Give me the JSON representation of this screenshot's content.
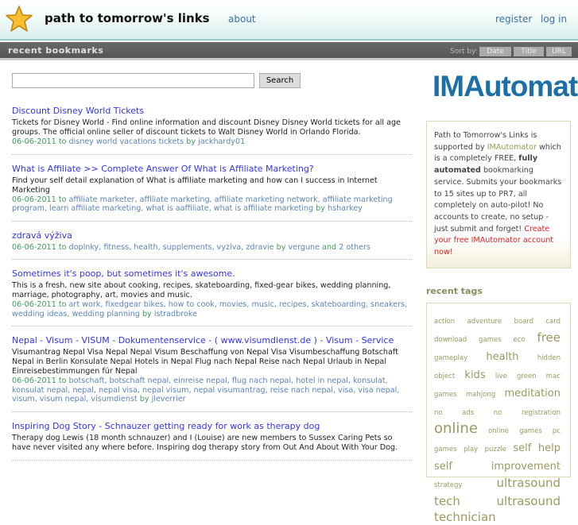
{
  "header": {
    "title": "path to tomorrow's links",
    "about": "about",
    "register": "register",
    "login": "log in"
  },
  "bar": {
    "title": "recent bookmarks",
    "sort_by": "Sort by:",
    "sort_options": [
      "Date",
      "Title",
      "URL"
    ]
  },
  "search": {
    "value": "",
    "button": "Search"
  },
  "bookmarks": [
    {
      "title": "Discount Disney World Tickets",
      "desc": "Tickets for Disney World - Find online information and discount Disney Disney World tickets for all age groups. The official online seller of discount tickets to Walt Disney World in Orlando Florida.",
      "date": "06-06-2011",
      "tags": "disney world vacations tickets",
      "user": "jackhardy01",
      "others": ""
    },
    {
      "title": "What is Affiliate >> Complete Answer Of What is Affiliate Marketing?",
      "desc": "Find your self detail explanation of What is affiliate marketing and how can I success in Internet Marketing",
      "date": "06-06-2011",
      "tags": "affiliate marketer, affiliate marketing, affiliate marketing network, affiliate marketing program, learn affiliate marketing, what is aaffiliate, what is affiliate marketing",
      "user": "hsharkey",
      "others": ""
    },
    {
      "title": "zdravá výživa",
      "desc": "",
      "date": "06-06-2011",
      "tags": "doplnky, fitness, health, supplements, vyziva, zdravie",
      "user": "vergune",
      "others": "2 others"
    },
    {
      "title": "Sometimes it's poop, but sometimes it's awesome.",
      "desc": "This is a fresh, new site about cooking, recipes, skateboarding, fixed-gear bikes, wedding planning, marriage, photography, art, movies and music.",
      "date": "06-06-2011",
      "tags": "art work, fixedgear bikes, how to cook, movies, music, recipes, skateboarding, sneakers, wedding ideas, wedding planning",
      "user": "istradbroke",
      "others": ""
    },
    {
      "title": "Nepal - Visum - VISUM - Dokumentenservice - ( www.visumdienst.de ) - Visum - Service",
      "desc": "Visumantrag Nepal Visa Nepal Nepal Visum Beschaffung von Nepal Visa Visumbeschaffung Botschaft Nepal in Berlin Konsulate Nepal Hotels in Nepal Flug nach Nepal Reise nach Nepal Urlaub in Nepal Einreisebestimmungen für Nepal",
      "date": "06-06-2011",
      "tags": "botschaft, botschaft nepal, einreise nepal, flug nach nepal, hotel in nepal, konsulat, konsulat nepal, nepal, nepal visa, nepal visum, nepal visumantrag, reise nach nepal, visa, visa nepal, visum, visum nepal, visumdienst",
      "user": "jleverrier",
      "others": ""
    },
    {
      "title": "Inspiring Dog Story - Schnauzer getting ready for work as therapy dog",
      "desc": "Therapy dog Lewis (18 month schnauzer) and I (Louise) are new members to Sussex Caring Pets so have never visited any where before. Inspiring dog therapy story from Out And About With Your Dog.",
      "date": "",
      "tags": "",
      "user": "",
      "others": ""
    }
  ],
  "words": {
    "to": "to",
    "by": "by",
    "and": "and"
  },
  "sidebar": {
    "logo": "IMAutomator",
    "promo": {
      "p1": "Path to Tomorrow's Links is supported by ",
      "link": "IMAutomator",
      "p2": " which is a completely FREE, ",
      "bold": "fully automated",
      "p3": " bookmarking service. Submits your bookmarks to 15 sites up to PR7, all completely on auto-pilot! No accounts to create, no setup - just submit and forget! ",
      "cta": "Create your free IMAutomator account now!"
    },
    "tags_title": "recent tags",
    "tags": [
      {
        "t": "action",
        "w": 1
      },
      {
        "t": "adventure",
        "w": 1
      },
      {
        "t": "board",
        "w": 1
      },
      {
        "t": "card",
        "w": 1
      },
      {
        "t": "download",
        "w": 1
      },
      {
        "t": "games",
        "w": 1
      },
      {
        "t": "eco",
        "w": 1
      },
      {
        "t": "free",
        "w": 4
      },
      {
        "t": "gameplay",
        "w": 1
      },
      {
        "t": "health",
        "w": 3
      },
      {
        "t": "hidden",
        "w": 1
      },
      {
        "t": "object",
        "w": 1
      },
      {
        "t": "kids",
        "w": 3
      },
      {
        "t": "live",
        "w": 1
      },
      {
        "t": "green",
        "w": 1
      },
      {
        "t": "mac",
        "w": 1
      },
      {
        "t": "games",
        "w": 1
      },
      {
        "t": "mahjong",
        "w": 1
      },
      {
        "t": "meditation",
        "w": 3
      },
      {
        "t": "no",
        "w": 1
      },
      {
        "t": "ads",
        "w": 1
      },
      {
        "t": "no",
        "w": 1
      },
      {
        "t": "registration",
        "w": 1
      },
      {
        "t": "online",
        "w": 5
      },
      {
        "t": "online",
        "w": 1
      },
      {
        "t": "games",
        "w": 1
      },
      {
        "t": "pc",
        "w": 1
      },
      {
        "t": "games",
        "w": 1
      },
      {
        "t": "play",
        "w": 1
      },
      {
        "t": "puzzle",
        "w": 1
      },
      {
        "t": "self",
        "w": 3
      },
      {
        "t": "help",
        "w": 3
      },
      {
        "t": "self",
        "w": 3
      },
      {
        "t": "improvement",
        "w": 3
      },
      {
        "t": "strategy",
        "w": 1
      },
      {
        "t": "ultrasound",
        "w": 4
      },
      {
        "t": "tech",
        "w": 4
      },
      {
        "t": "ultrasound",
        "w": 4
      },
      {
        "t": "technician",
        "w": 4
      }
    ]
  }
}
